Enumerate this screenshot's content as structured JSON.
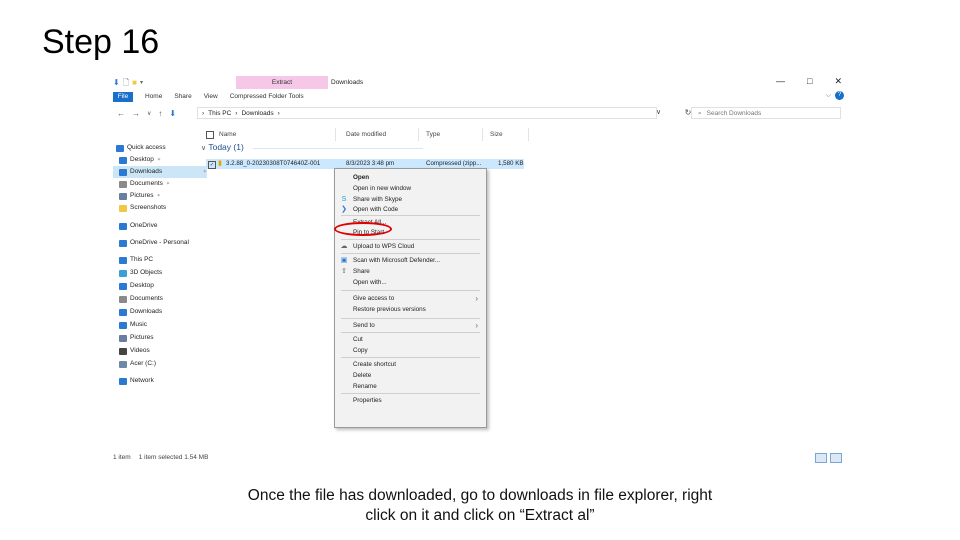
{
  "slide": {
    "title": "Step 16",
    "caption_line1": "Once the file has downloaded, go to downloads in file explorer, right",
    "caption_line2": "click on it and click on “Extract al”"
  },
  "window": {
    "title": "Downloads",
    "contextual_tab": "Extract",
    "controls": [
      "—",
      "□",
      "✕"
    ]
  },
  "ribbon": {
    "tabs": [
      "File",
      "Home",
      "Share",
      "View",
      "Compressed Folder Tools"
    ]
  },
  "address": {
    "crumbs": [
      "This PC",
      "›",
      "Downloads",
      "›"
    ],
    "search_placeholder": "Search Downloads"
  },
  "nav_pane": {
    "items": [
      {
        "label": "Quick access",
        "icon": "star-icon",
        "color": "#2b79d0",
        "pinned": false
      },
      {
        "label": "Desktop",
        "icon": "desktop-icon",
        "color": "#2b79d0",
        "pinned": true
      },
      {
        "label": "Downloads",
        "icon": "download-icon",
        "color": "#2b79d0",
        "pinned": true,
        "selected": true
      },
      {
        "label": "Documents",
        "icon": "documents-icon",
        "color": "#8a8a8a",
        "pinned": true
      },
      {
        "label": "Pictures",
        "icon": "pictures-icon",
        "color": "#6a7fa0",
        "pinned": true
      },
      {
        "label": "Screenshots",
        "icon": "folder-icon",
        "color": "#f2c744",
        "pinned": false
      },
      {
        "label": "OneDrive",
        "icon": "cloud-icon",
        "color": "#2b79d0",
        "pinned": false
      },
      {
        "label": "OneDrive - Personal",
        "icon": "cloud-icon",
        "color": "#2b79d0",
        "pinned": false
      },
      {
        "label": "This PC",
        "icon": "pc-icon",
        "color": "#2b79d0",
        "pinned": false
      },
      {
        "label": "3D Objects",
        "icon": "cube-icon",
        "color": "#3aa0d8",
        "pinned": false
      },
      {
        "label": "Desktop",
        "icon": "desktop-icon",
        "color": "#2b79d0",
        "pinned": false
      },
      {
        "label": "Documents",
        "icon": "documents-icon",
        "color": "#8a8a8a",
        "pinned": false
      },
      {
        "label": "Downloads",
        "icon": "download-icon",
        "color": "#2b79d0",
        "pinned": false
      },
      {
        "label": "Music",
        "icon": "music-icon",
        "color": "#2b79d0",
        "pinned": false
      },
      {
        "label": "Pictures",
        "icon": "pictures-icon",
        "color": "#6a7fa0",
        "pinned": false
      },
      {
        "label": "Videos",
        "icon": "video-icon",
        "color": "#444444",
        "pinned": false
      },
      {
        "label": "Acer (C:)",
        "icon": "drive-icon",
        "color": "#6c8aa8",
        "pinned": false
      },
      {
        "label": "Network",
        "icon": "network-icon",
        "color": "#2b79d0",
        "pinned": false
      }
    ]
  },
  "columns": [
    "Name",
    "Date modified",
    "Type",
    "Size"
  ],
  "group_label": "Today (1)",
  "file": {
    "name": "3.2.88_0-20230308T074640Z-001",
    "date": "8/3/2023 3:48 pm",
    "type": "Compressed (zipp...",
    "size": "1,580 KB"
  },
  "context_menu": {
    "items": [
      {
        "label": "Open",
        "bold": true
      },
      {
        "label": "Open in new window"
      },
      {
        "label": "Share with Skype",
        "icon": "skype-icon"
      },
      {
        "label": "Open with Code",
        "icon": "vscode-icon"
      },
      {
        "label": "Extract All..."
      },
      {
        "label": "Pin to Start"
      },
      {
        "label": "Upload to WPS Cloud",
        "icon": "cloud-outline-icon"
      },
      {
        "label": "Scan with Microsoft Defender...",
        "icon": "defender-icon"
      },
      {
        "label": "Share",
        "icon": "share-icon"
      },
      {
        "label": "Open with..."
      },
      {
        "label": "Give access to",
        "submenu": true
      },
      {
        "label": "Restore previous versions"
      },
      {
        "label": "Send to",
        "submenu": true
      },
      {
        "label": "Cut"
      },
      {
        "label": "Copy"
      },
      {
        "label": "Create shortcut"
      },
      {
        "label": "Delete"
      },
      {
        "label": "Rename"
      },
      {
        "label": "Properties"
      }
    ]
  },
  "status_bar": {
    "count": "1 item",
    "selection": "1 item selected  1.54 MB"
  },
  "accent_color": "#1a6fc9",
  "annotation_color": "#e00000"
}
